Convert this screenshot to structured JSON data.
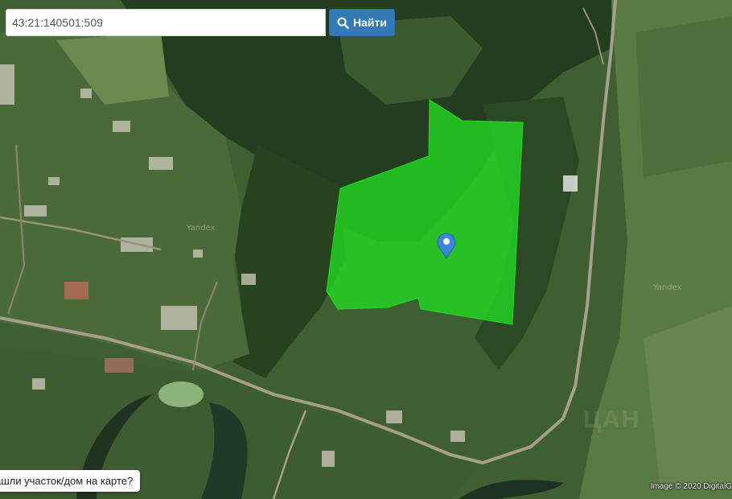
{
  "search": {
    "value": "43:21:140501:509",
    "button_label": "Найти",
    "icon": "search-icon"
  },
  "watermarks": [
    "Yandex",
    "Yandex"
  ],
  "hint": {
    "label": "ашли участок/дом на карте?"
  },
  "credit": {
    "text": "Image © 2020 DigitalG"
  },
  "colors": {
    "parcel": "#22dd22",
    "marker": "#3a86d8",
    "button": "#337ab7"
  },
  "marker": {
    "icon": "map-pin-icon"
  }
}
